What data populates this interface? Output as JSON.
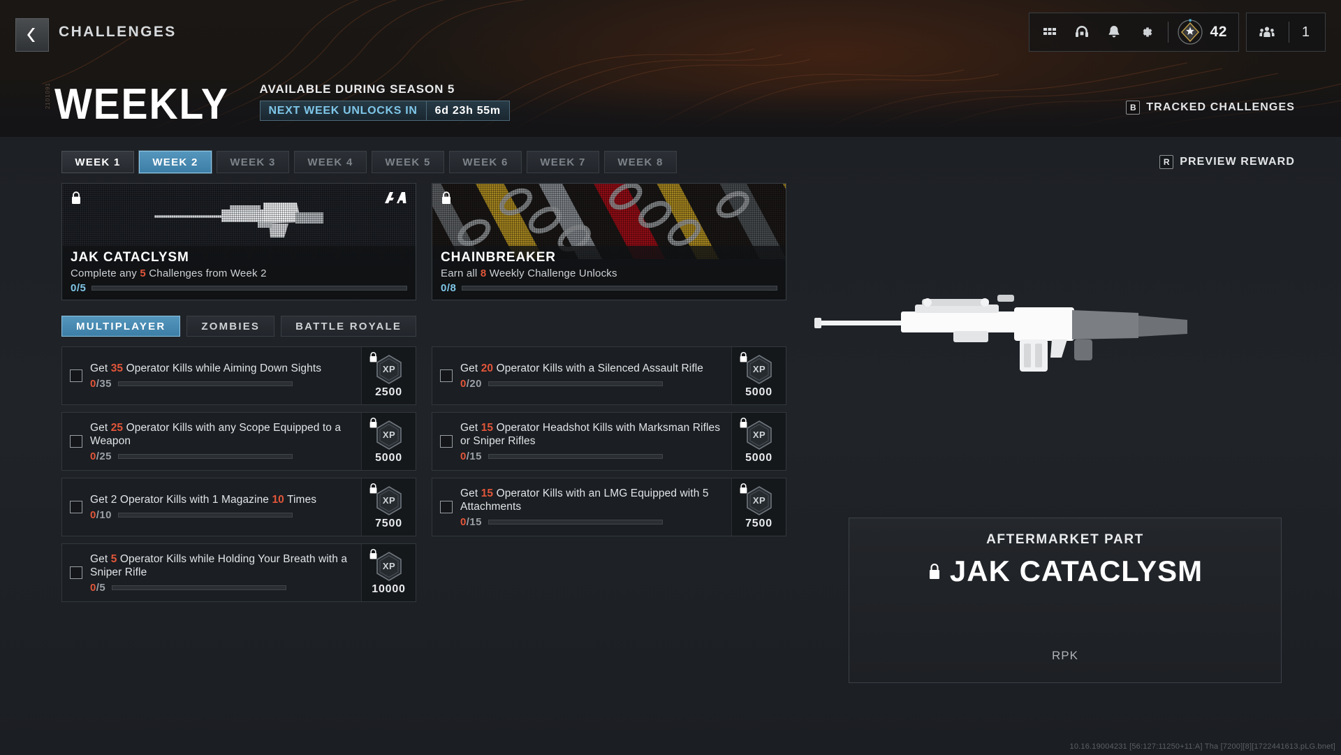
{
  "header": {
    "back_icon": "chevron-left-icon",
    "breadcrumb": "CHALLENGES",
    "icons": [
      {
        "name": "grid-apps-icon",
        "glyph": "grid"
      },
      {
        "name": "headset-icon",
        "glyph": "headset"
      },
      {
        "name": "bell-notification-icon",
        "glyph": "bell"
      },
      {
        "name": "gear-settings-icon",
        "glyph": "gear"
      }
    ],
    "rank": {
      "icon": "rank-badge-icon",
      "value": "42"
    },
    "squad": {
      "icon": "squad-members-icon",
      "value": "1"
    }
  },
  "title": {
    "side_code": "2101091",
    "heading": "WEEKLY",
    "availability": "AVAILABLE DURING SEASON 5",
    "timer_label": "NEXT WEEK UNLOCKS IN",
    "timer_value": "6d 23h 55m"
  },
  "tracked_challenges": {
    "key": "B",
    "label": "TRACKED CHALLENGES"
  },
  "preview_reward": {
    "key": "R",
    "label": "PREVIEW REWARD"
  },
  "week_tabs": [
    {
      "label": "WEEK 1",
      "state": "done"
    },
    {
      "label": "WEEK 2",
      "state": "selected"
    },
    {
      "label": "WEEK 3",
      "state": "locked"
    },
    {
      "label": "WEEK 4",
      "state": "locked"
    },
    {
      "label": "WEEK 5",
      "state": "locked"
    },
    {
      "label": "WEEK 6",
      "state": "locked"
    },
    {
      "label": "WEEK 7",
      "state": "locked"
    },
    {
      "label": "WEEK 8",
      "state": "locked"
    }
  ],
  "reward_cards": [
    {
      "name": "JAK CATACLYSM",
      "desc_pre": "Complete any ",
      "desc_hl": "5",
      "desc_post": " Challenges from Week 2",
      "progress_text": "0/5",
      "progress_pct": 0,
      "locked": true,
      "art": "weapon-silhouette",
      "brand_icon": "aftermarket-part-logo"
    },
    {
      "name": "CHAINBREAKER",
      "desc_pre": "Earn all ",
      "desc_hl": "8",
      "desc_post": " Weekly Challenge Unlocks",
      "progress_text": "0/8",
      "progress_pct": 0,
      "locked": true,
      "art": "chain-camo",
      "brand_icon": ""
    }
  ],
  "mode_tabs": [
    {
      "label": "MULTIPLAYER",
      "state": "selected"
    },
    {
      "label": "ZOMBIES",
      "state": "normal"
    },
    {
      "label": "BATTLE ROYALE",
      "state": "normal"
    }
  ],
  "challenges_left": [
    {
      "parts": [
        {
          "t": "Get ",
          "hl": false
        },
        {
          "t": "35",
          "hl": true
        },
        {
          "t": " Operator Kills while Aiming Down Sights",
          "hl": false
        }
      ],
      "current": "0",
      "sep": "/",
      "goal": "35",
      "progress_pct": 0,
      "xp": "2500",
      "xp_icon": "xp-hexagon-icon",
      "locked": true
    },
    {
      "parts": [
        {
          "t": "Get ",
          "hl": false
        },
        {
          "t": "25",
          "hl": true
        },
        {
          "t": " Operator Kills with any Scope Equipped to a Weapon",
          "hl": false
        }
      ],
      "current": "0",
      "sep": "/",
      "goal": "25",
      "progress_pct": 0,
      "xp": "5000",
      "xp_icon": "xp-hexagon-icon",
      "locked": true
    },
    {
      "parts": [
        {
          "t": "Get 2 Operator Kills with 1 Magazine ",
          "hl": false
        },
        {
          "t": "10",
          "hl": true
        },
        {
          "t": " Times",
          "hl": false
        }
      ],
      "current": "0",
      "sep": "/",
      "goal": "10",
      "progress_pct": 0,
      "xp": "7500",
      "xp_icon": "xp-hexagon-icon",
      "locked": true
    },
    {
      "parts": [
        {
          "t": "Get ",
          "hl": false
        },
        {
          "t": "5",
          "hl": true
        },
        {
          "t": " Operator Kills while Holding Your Breath with a Sniper Rifle",
          "hl": false
        }
      ],
      "current": "0",
      "sep": "/",
      "goal": "5",
      "progress_pct": 0,
      "xp": "10000",
      "xp_icon": "xp-hexagon-icon",
      "locked": true
    }
  ],
  "challenges_right": [
    {
      "parts": [
        {
          "t": "Get ",
          "hl": false
        },
        {
          "t": "20",
          "hl": true
        },
        {
          "t": " Operator Kills with a Silenced Assault Rifle",
          "hl": false
        }
      ],
      "current": "0",
      "sep": "/",
      "goal": "20",
      "progress_pct": 0,
      "xp": "5000",
      "xp_icon": "xp-hexagon-icon",
      "locked": true
    },
    {
      "parts": [
        {
          "t": "Get ",
          "hl": false
        },
        {
          "t": "15",
          "hl": true
        },
        {
          "t": " Operator Headshot Kills with Marksman Rifles or Sniper Rifles",
          "hl": false
        }
      ],
      "current": "0",
      "sep": "/",
      "goal": "15",
      "progress_pct": 0,
      "xp": "5000",
      "xp_icon": "xp-hexagon-icon",
      "locked": true
    },
    {
      "parts": [
        {
          "t": "Get ",
          "hl": false
        },
        {
          "t": "15",
          "hl": true
        },
        {
          "t": " Operator Kills with an LMG Equipped with 5 Attachments",
          "hl": false
        }
      ],
      "current": "0",
      "sep": "/",
      "goal": "15",
      "progress_pct": 0,
      "xp": "7500",
      "xp_icon": "xp-hexagon-icon",
      "locked": true
    }
  ],
  "reward_panel": {
    "kind": "AFTERMARKET PART",
    "name": "JAK CATACLYSM",
    "weapon": "RPK",
    "locked": true
  },
  "build_string": "10.16.19004231 [56:127:11250+11:A] Tha [7200][8][1722441613.pLG.bnet]",
  "colors": {
    "accent_blue": "#4f8fb8",
    "highlight_blue": "#7fc6e8",
    "highlight_orange": "#e2563a",
    "panel_bg": "#1b1e22"
  }
}
